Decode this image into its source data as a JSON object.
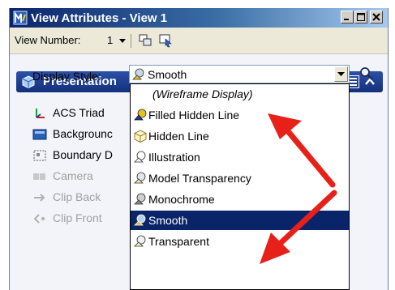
{
  "window": {
    "title": "View Attributes - View 1"
  },
  "toolbar": {
    "view_number_label": "View Number:",
    "view_number_value": "1"
  },
  "panel": {
    "title": "Presentation"
  },
  "display_style": {
    "label": "Display Style:",
    "value": "Smooth"
  },
  "tools": [
    {
      "label": "ACS Triad",
      "icon": "acs-triad-icon",
      "enabled": true
    },
    {
      "label": "Backgrounc",
      "icon": "background-icon",
      "enabled": true
    },
    {
      "label": "Boundary D",
      "icon": "boundary-icon",
      "enabled": true
    },
    {
      "label": "Camera",
      "icon": "camera-icon",
      "enabled": false
    },
    {
      "label": "Clip Back",
      "icon": "clip-back-icon",
      "enabled": false
    },
    {
      "label": "Clip Front",
      "icon": "clip-front-icon",
      "enabled": false
    }
  ],
  "dropdown": {
    "options": [
      {
        "label": "(Wireframe Display)",
        "header": true
      },
      {
        "label": "Filled Hidden Line"
      },
      {
        "label": "Hidden Line"
      },
      {
        "label": "Illustration"
      },
      {
        "label": "Model Transparency"
      },
      {
        "label": "Monochrome"
      },
      {
        "label": "Smooth",
        "selected": true
      },
      {
        "label": "Transparent"
      }
    ]
  },
  "colors": {
    "accent": "#0a246a",
    "annotation_arrow": "#e8201a",
    "panel_header": "#1c3d8f"
  }
}
